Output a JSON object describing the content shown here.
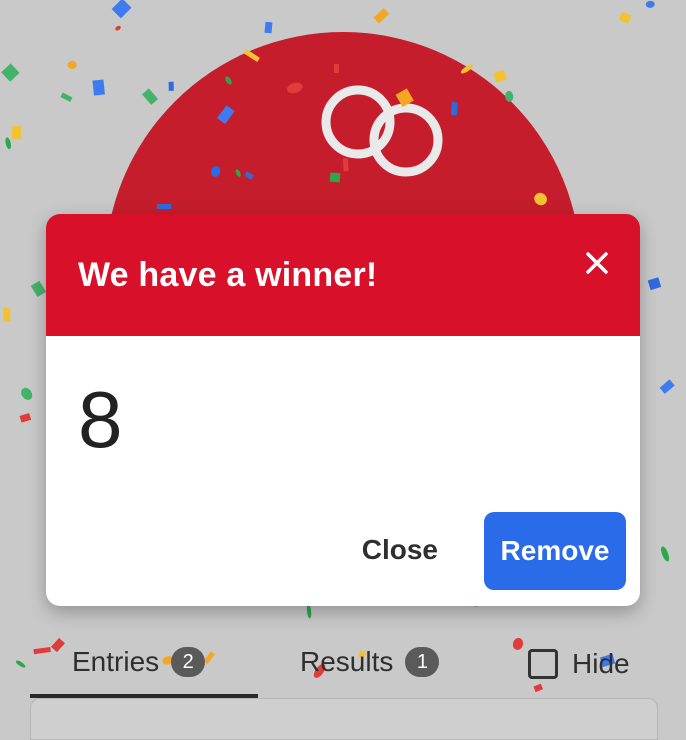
{
  "wheel": {
    "color": "#c51d2c",
    "logo": "infinity-ring-logo"
  },
  "dialog": {
    "title": "We have a winner!",
    "winner": "8",
    "close_label": "Close",
    "remove_label": "Remove",
    "header_color": "#d8102a",
    "remove_color": "#2a6bea",
    "close_icon": "close-icon"
  },
  "tabs": {
    "entries_label": "Entries",
    "entries_count": "2",
    "results_label": "Results",
    "results_count": "1",
    "hide_label": "Hide",
    "hide_checked": false
  }
}
